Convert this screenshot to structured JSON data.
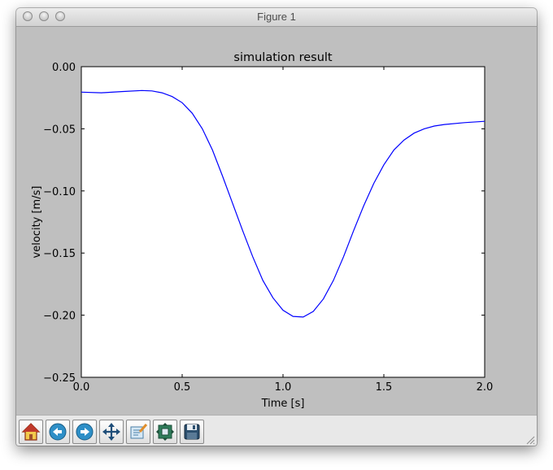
{
  "window": {
    "title": "Figure 1"
  },
  "toolbar": {
    "buttons": [
      {
        "icon": "home-icon"
      },
      {
        "icon": "back-icon"
      },
      {
        "icon": "forward-icon"
      },
      {
        "icon": "pan-icon"
      },
      {
        "icon": "zoom-to-rect-icon"
      },
      {
        "icon": "configure-subplots-icon"
      },
      {
        "icon": "save-icon"
      }
    ]
  },
  "chart_data": {
    "type": "line",
    "title": "simulation result",
    "xlabel": "Time [s]",
    "ylabel": "velocity [m/s]",
    "xlim": [
      0.0,
      2.0
    ],
    "ylim": [
      -0.25,
      0.0
    ],
    "x_ticks": [
      "0.0",
      "0.5",
      "1.0",
      "1.5",
      "2.0"
    ],
    "y_ticks": [
      "0.00",
      "−0.05",
      "−0.10",
      "−0.15",
      "−0.20",
      "−0.25"
    ],
    "grid": false,
    "line_color": "#0000ff",
    "series": [
      {
        "x": [
          0.0,
          0.1,
          0.2,
          0.3,
          0.35,
          0.4,
          0.45,
          0.5,
          0.55,
          0.6,
          0.65,
          0.7,
          0.75,
          0.8,
          0.85,
          0.9,
          0.95,
          1.0,
          1.05,
          1.1,
          1.15,
          1.2,
          1.25,
          1.3,
          1.35,
          1.4,
          1.45,
          1.5,
          1.55,
          1.6,
          1.65,
          1.7,
          1.75,
          1.8,
          1.9,
          2.0
        ],
        "y": [
          -0.0205,
          -0.021,
          -0.02,
          -0.0192,
          -0.0195,
          -0.021,
          -0.024,
          -0.029,
          -0.0375,
          -0.05,
          -0.067,
          -0.088,
          -0.11,
          -0.132,
          -0.153,
          -0.172,
          -0.186,
          -0.196,
          -0.201,
          -0.2015,
          -0.197,
          -0.187,
          -0.172,
          -0.153,
          -0.132,
          -0.112,
          -0.094,
          -0.079,
          -0.067,
          -0.059,
          -0.0535,
          -0.05,
          -0.0478,
          -0.0465,
          -0.045,
          -0.044
        ]
      }
    ]
  }
}
